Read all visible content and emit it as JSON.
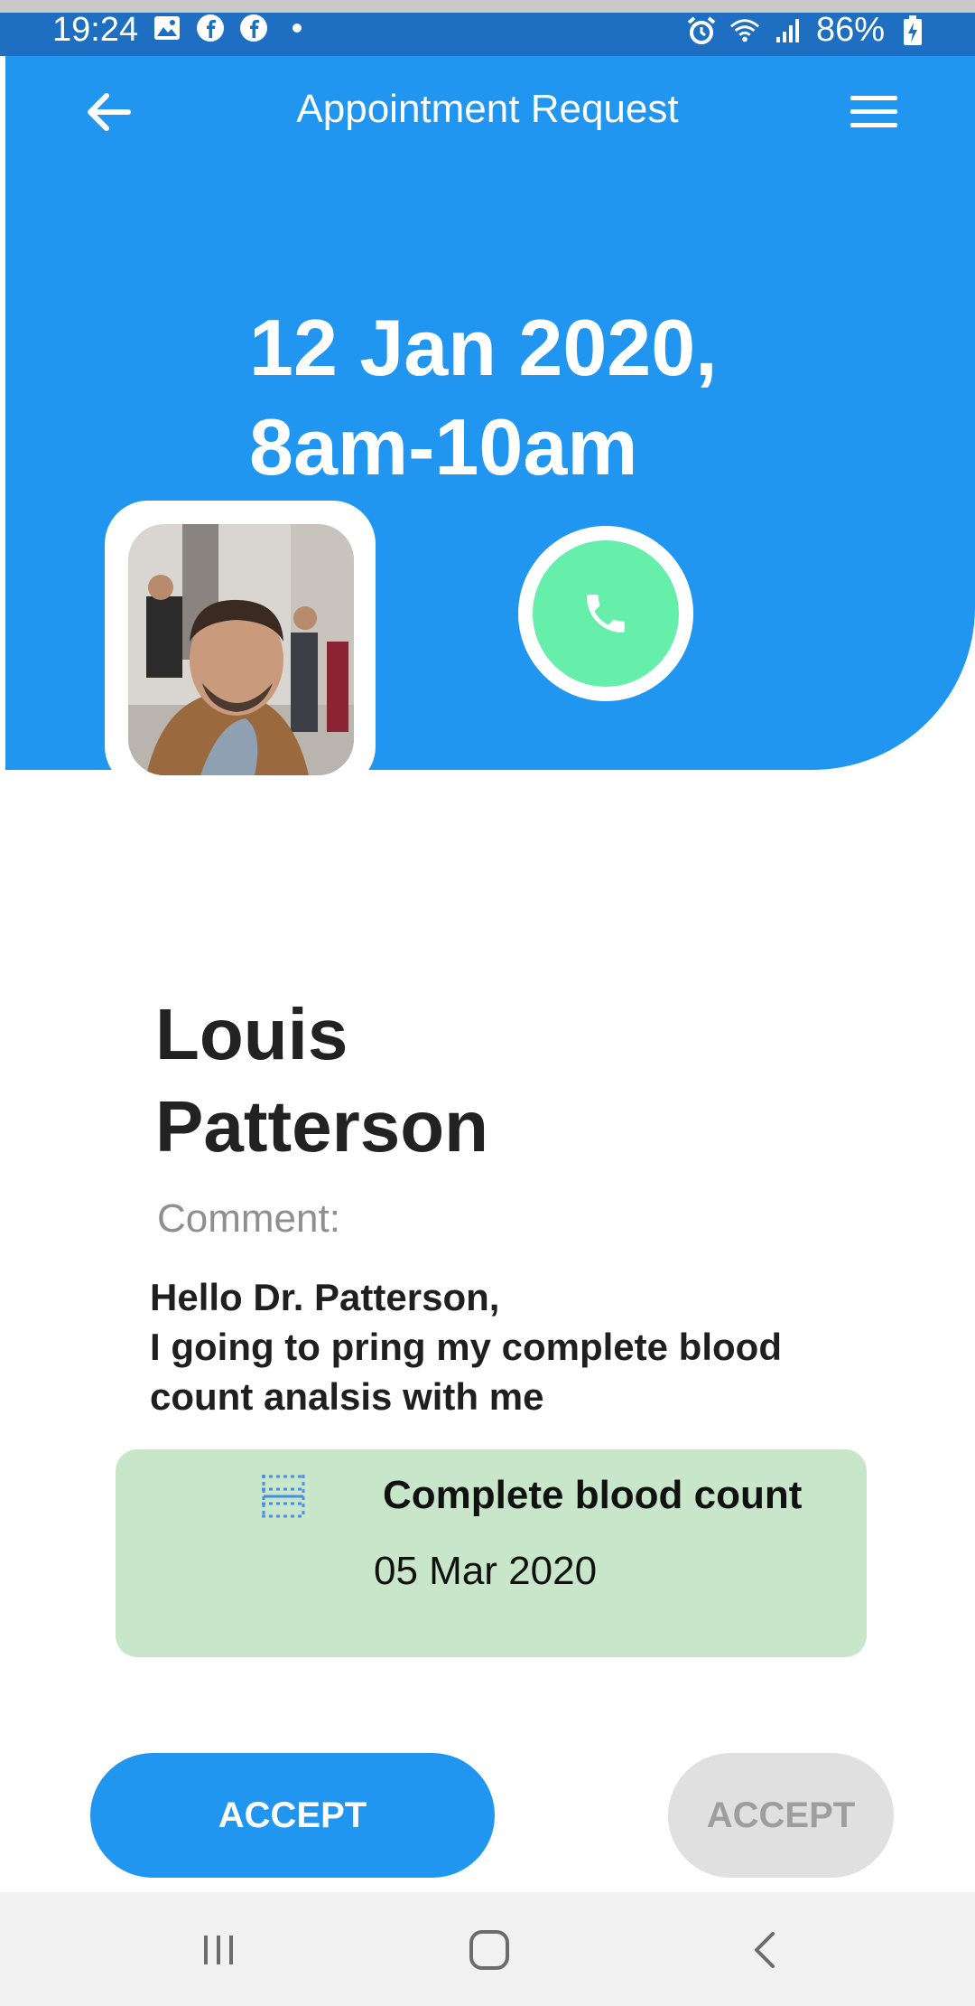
{
  "status_bar": {
    "time": "19:24",
    "left_icons": [
      "image-icon",
      "facebook-icon",
      "facebook-icon",
      "dot-icon"
    ],
    "right_icons": [
      "alarm-icon",
      "wifi-icon",
      "signal-icon"
    ],
    "battery": "86%"
  },
  "app_bar": {
    "title": "Appointment Request",
    "back_icon": "arrow-left-icon",
    "menu_icon": "hamburger-menu-icon"
  },
  "appointment": {
    "date_line1": "12 Jan 2020,",
    "date_line2": "8am-10am"
  },
  "patient": {
    "first_name": "Louis",
    "last_name": "Patterson",
    "call_icon": "phone-icon"
  },
  "comment": {
    "label": "Comment:",
    "lines": [
      "Hello Dr. Patterson,",
      "I going to pring my complete blood",
      "count analsis with me"
    ]
  },
  "attachment": {
    "icon": "document-grid-icon",
    "name": "Complete blood count",
    "date": "05 Mar 2020"
  },
  "actions": {
    "accept_label": "ACCEPT",
    "accept_disabled_label": "ACCEPT"
  },
  "colors": {
    "primary": "#2196f0",
    "call_green": "#66efaa",
    "card_green": "#c8e6c9",
    "disabled_grey": "#e0e0e0"
  }
}
